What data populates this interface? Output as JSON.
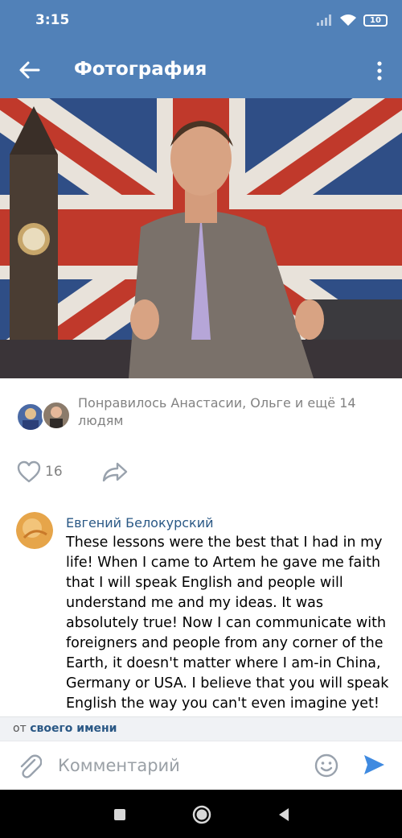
{
  "status_bar": {
    "time": "3:15",
    "battery": "10"
  },
  "app_bar": {
    "title": "Фотография"
  },
  "likes": {
    "text": "Понравилось Анастасии, Ольге и ещё 14 людям"
  },
  "actions": {
    "like_count": "16"
  },
  "comment": {
    "author": "Евгений Белокурский",
    "text": "These lessons were the best that I had in my life! When I came to Artem he gave me faith that I will speak English and people will understand me and my ideas. It was absolutely true! Now I can communicate with foreigners and people from any corner of the Earth, it doesn't matter where I am-in China, Germany or USA. I believe that you will speak English the way you can't even imagine yet!"
  },
  "from_bar": {
    "prefix": "от",
    "link": "своего имени"
  },
  "composer": {
    "placeholder": "Комментарий"
  },
  "colors": {
    "brand": "#5181b8",
    "link": "#2a5885",
    "muted": "#828282",
    "send": "#3f8ae0"
  }
}
